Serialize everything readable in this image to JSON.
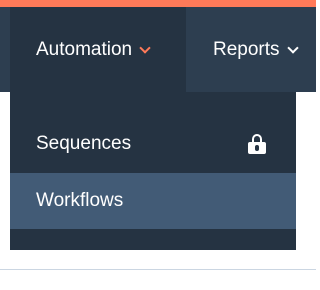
{
  "topnav": {
    "items": [
      {
        "label": "Automation",
        "active": true
      },
      {
        "label": "Reports",
        "active": false
      }
    ]
  },
  "dropdown": {
    "items": [
      {
        "label": "Sequences",
        "icon": "lock-icon",
        "locked": true
      },
      {
        "label": "Workflows",
        "hovered": true
      }
    ]
  },
  "colors": {
    "accent": "#ff7a59",
    "nav_bg": "#2d3e50",
    "nav_active_bg": "#253342",
    "dropdown_bg": "#253342",
    "dropdown_hover_bg": "#425b76",
    "divider": "#cbd6e2"
  }
}
